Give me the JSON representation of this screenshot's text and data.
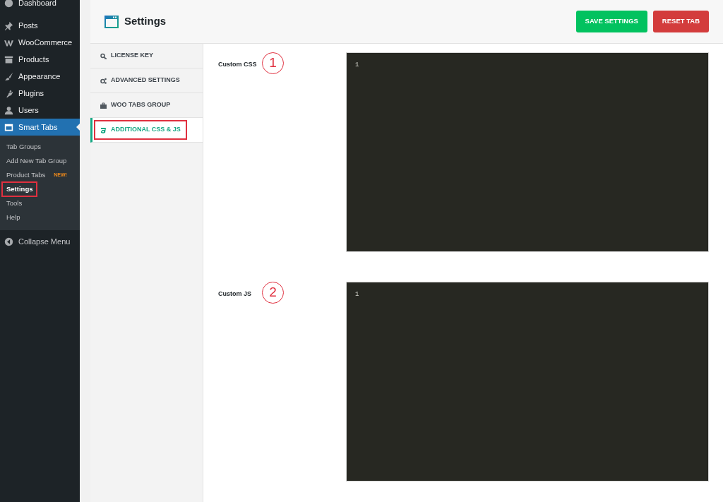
{
  "admin_menu": {
    "items": [
      {
        "label": "Dashboard",
        "selected": false
      },
      {
        "label": "Posts",
        "selected": false
      },
      {
        "label": "WooCommerce",
        "selected": false
      },
      {
        "label": "Products",
        "selected": false
      },
      {
        "label": "Appearance",
        "selected": false
      },
      {
        "label": "Plugins",
        "selected": false
      },
      {
        "label": "Users",
        "selected": false
      },
      {
        "label": "Smart Tabs",
        "selected": true,
        "children": [
          {
            "label": "Tab Groups",
            "selected": false,
            "highlighted": false
          },
          {
            "label": "Add New Tab Group",
            "selected": false,
            "highlighted": false
          },
          {
            "label": "Product Tabs",
            "badge": "NEW!",
            "selected": false,
            "highlighted": false
          },
          {
            "label": "Settings",
            "selected": true,
            "highlighted": true
          },
          {
            "label": "Tools",
            "selected": false,
            "highlighted": false
          },
          {
            "label": "Help",
            "selected": false,
            "highlighted": false
          }
        ]
      }
    ],
    "collapse": "Collapse Menu"
  },
  "header": {
    "title": "Settings",
    "buttons": [
      {
        "label": "SAVE SETTINGS",
        "kind": "save"
      },
      {
        "label": "RESET TAB",
        "kind": "reset"
      }
    ]
  },
  "tabs": [
    {
      "label": "LICENSE KEY",
      "selected": false,
      "highlighted": false
    },
    {
      "label": "ADVANCED SETTINGS",
      "selected": false,
      "highlighted": false
    },
    {
      "label": "WOO TABS GROUP",
      "selected": false,
      "highlighted": false
    },
    {
      "label": "ADDITIONAL CSS & JS",
      "selected": true,
      "highlighted": true
    }
  ],
  "fields": [
    {
      "label": "Custom CSS",
      "callout": "1",
      "line_number": "1"
    },
    {
      "label": "Custom JS",
      "callout": "2",
      "line_number": "1"
    }
  ]
}
